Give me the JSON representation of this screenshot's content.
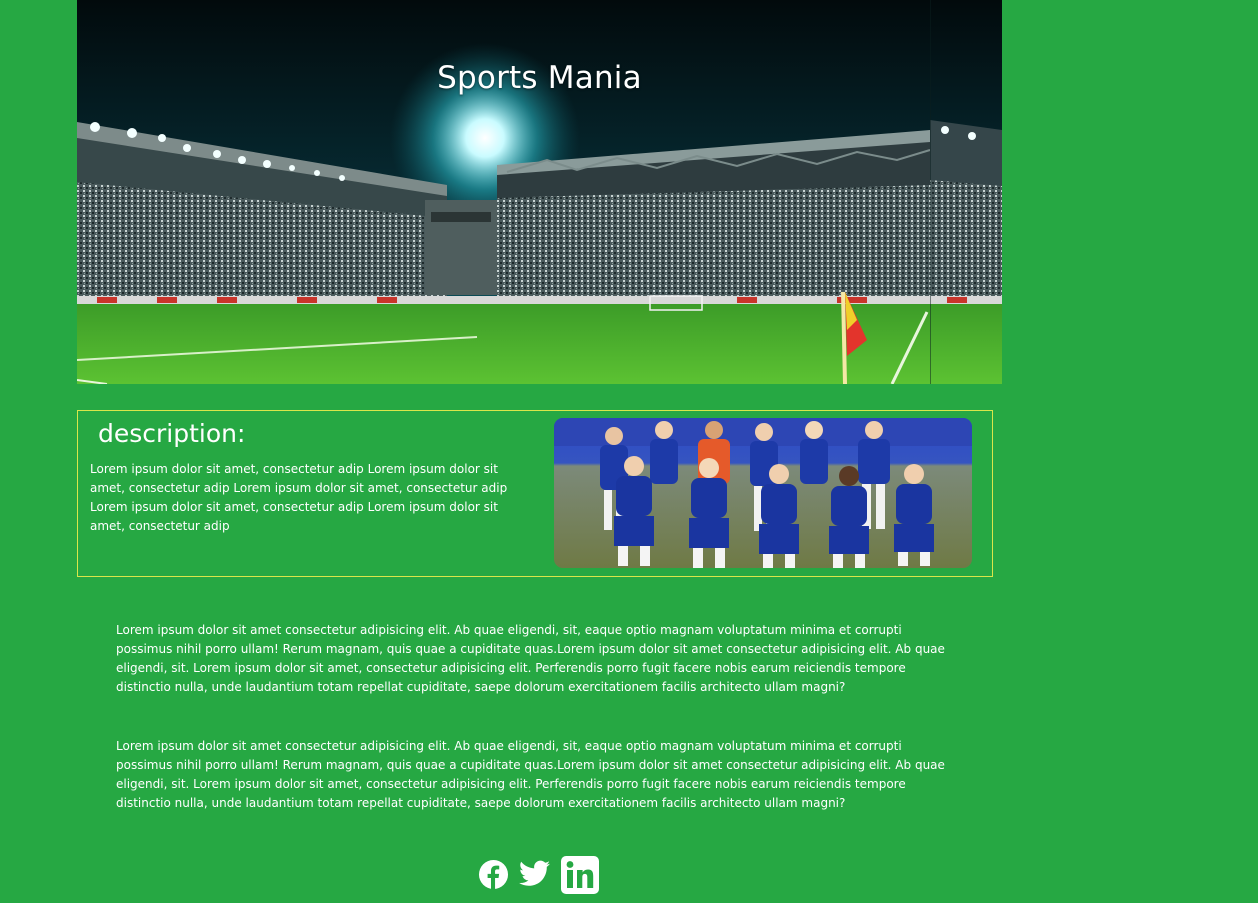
{
  "hero": {
    "title": "Sports Mania"
  },
  "description": {
    "heading": "description:",
    "text": "Lorem ipsum dolor sit amet, consectetur adip Lorem ipsum dolor sit amet, consectetur adip Lorem ipsum dolor sit amet, consectetur adip Lorem ipsum dolor sit amet, consectetur adip Lorem ipsum dolor sit amet, consectetur adip"
  },
  "paragraphs": [
    "Lorem ipsum dolor sit amet consectetur adipisicing elit. Ab quae eligendi, sit, eaque optio magnam voluptatum minima et corrupti possimus nihil porro ullam! Rerum magnam, quis quae a cupiditate quas.Lorem ipsum dolor sit amet consectetur adipisicing elit. Ab quae eligendi, sit. Lorem ipsum dolor sit amet, consectetur adipisicing elit. Perferendis porro fugit facere nobis earum reiciendis tempore distinctio nulla, unde laudantium totam repellat cupiditate, saepe dolorum exercitationem facilis architecto ullam magni?",
    "Lorem ipsum dolor sit amet consectetur adipisicing elit. Ab quae eligendi, sit, eaque optio magnam voluptatum minima et corrupti possimus nihil porro ullam! Rerum magnam, quis quae a cupiditate quas.Lorem ipsum dolor sit amet consectetur adipisicing elit. Ab quae eligendi, sit. Lorem ipsum dolor sit amet, consectetur adipisicing elit. Perferendis porro fugit facere nobis earum reiciendis tempore distinctio nulla, unde laudantium totam repellat cupiditate, saepe dolorum exercitationem facilis architecto ullam magni?"
  ],
  "social": {
    "icons": [
      "facebook-icon",
      "twitter-icon",
      "linkedin-icon"
    ]
  },
  "colors": {
    "background": "#26a843",
    "box_border": "#d9e64a",
    "text": "#ffffff"
  }
}
